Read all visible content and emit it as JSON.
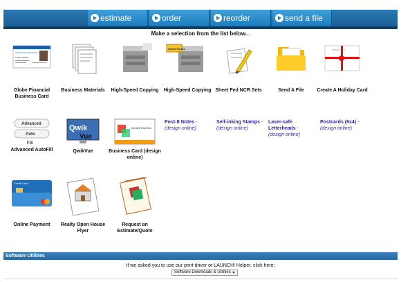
{
  "nav": {
    "estimate": "estimate",
    "order": "order",
    "reorder": "reorder",
    "send_file": "send a file"
  },
  "instruction": "Make a selection from the list below...",
  "items": [
    {
      "label": "Globe Financial Business Card"
    },
    {
      "label": "Business Materials"
    },
    {
      "label": "High-Speed Copying"
    },
    {
      "label": "High-Speed Copying"
    },
    {
      "label": "Sheet Fed NCR Sets"
    },
    {
      "label": "Send A File"
    },
    {
      "label": "Create A Holiday Card"
    },
    {
      "label": "Advanced AutoFill"
    },
    {
      "label": "QwikVue"
    },
    {
      "label": "Business Card (design online)"
    },
    {
      "label": "Online Payment"
    },
    {
      "label": "Realty Open House Flyer"
    },
    {
      "label": "Request an Estimate/Quote"
    }
  ],
  "thumb_text": {
    "smart_forms": "Smart Forms",
    "sample_text": "Sample Text",
    "advanced": "Advanced",
    "auto": "Auto",
    "fill": "Fill",
    "qwik": "Qwik",
    "vue": "Vue",
    "ezcard": "ezCard Express",
    "credit_card": "Credit Card",
    "globe_card_title": "Globe Financial Partners",
    "globe_card_name": "KATIE JONES"
  },
  "links": [
    {
      "title": "Post-It Notes",
      "sep": " - ",
      "note": "(design online)"
    },
    {
      "title": "Self-inking Stamps",
      "sep": " - ",
      "note": "(design online)"
    },
    {
      "title": "Laser-safe Letterheads",
      "sep": " - ",
      "note": "(design online)"
    },
    {
      "title": "Postcards (6x4)",
      "sep": " - ",
      "note": "(design online)"
    }
  ],
  "utilities": {
    "heading": "Software Utilities",
    "prompt": "If we asked you to use our print driver or LAUNCH! Helper, click here:",
    "select_value": "Software Downloads & Utilities"
  }
}
